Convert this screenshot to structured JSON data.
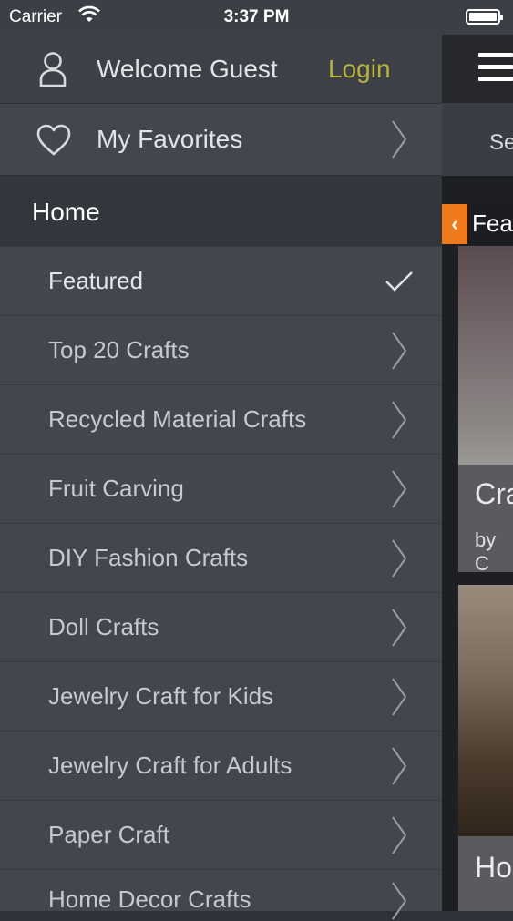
{
  "status_bar": {
    "carrier": "Carrier",
    "time": "3:37 PM"
  },
  "menu": {
    "welcome": {
      "text": "Welcome Guest",
      "login": "Login"
    },
    "favorites": "My Favorites",
    "section": "Home",
    "items": [
      {
        "label": "Featured",
        "selected": true
      },
      {
        "label": "Top 20 Crafts"
      },
      {
        "label": "Recycled Material Crafts"
      },
      {
        "label": "Fruit Carving"
      },
      {
        "label": "DIY Fashion Crafts"
      },
      {
        "label": "Doll Crafts"
      },
      {
        "label": "Jewelry Craft for Kids"
      },
      {
        "label": "Jewelry Craft for Adults"
      },
      {
        "label": "Paper Craft"
      },
      {
        "label": "Home Decor Crafts"
      }
    ]
  },
  "main_peek": {
    "search_text": "Se",
    "featured_tab": "Fea",
    "card1_title": "Cra",
    "card1_byline": "by C",
    "card2_title": "Ho"
  },
  "colors": {
    "accent_login": "#b7b23b",
    "accent_orange": "#f07a1b"
  }
}
